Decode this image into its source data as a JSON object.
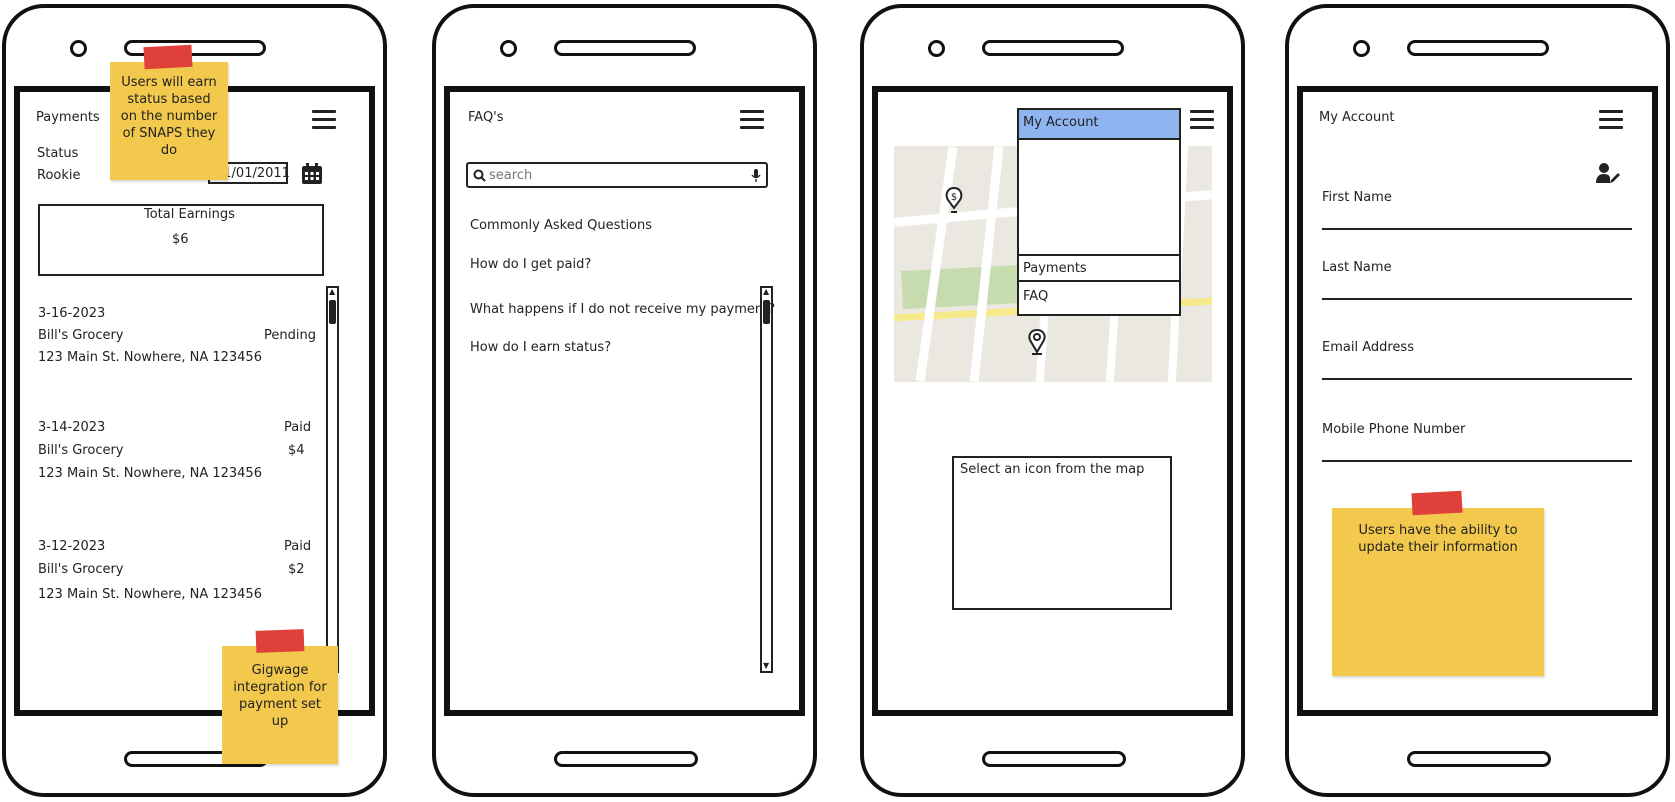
{
  "notes": {
    "status_note": "Users will earn status based on the number of SNAPS they do",
    "gigwage_note": "Gigwage integration for payment set up",
    "update_note": "Users have the ability to update their information"
  },
  "payments_screen": {
    "title": "Payments",
    "status_label": "Status",
    "status_value": "Rookie",
    "date_value": "01/01/2011",
    "total_label": "Total Earnings",
    "total_value": "$6",
    "transactions": [
      {
        "date": "3-16-2023",
        "store": "Bill's Grocery",
        "status": "Pending",
        "amount": "",
        "address": "123 Main St. Nowhere, NA 123456"
      },
      {
        "date": "3-14-2023",
        "store": "Bill's Grocery",
        "status": "Paid",
        "amount": "$4",
        "address": "123 Main St. Nowhere, NA 123456"
      },
      {
        "date": "3-12-2023",
        "store": "Bill's Grocery",
        "status": "Paid",
        "amount": "$2",
        "address": "123 Main St. Nowhere, NA 123456"
      }
    ]
  },
  "faq_screen": {
    "title": "FAQ's",
    "search_placeholder": "search",
    "heading": "Commonly Asked Questions",
    "questions": [
      "How do I get paid?",
      "What happens if I do not receive my payment?",
      "How do I earn status?"
    ]
  },
  "map_screen": {
    "menu_items": [
      "My Account",
      "Payments",
      "FAQ"
    ],
    "info_box_text": "Select an icon from the map",
    "colors": {
      "menu_selected": "#8fb5f0",
      "park": "#c6dcae",
      "road_highlight": "#f5e98a"
    }
  },
  "account_screen": {
    "title": "My Account",
    "fields": [
      "First Name",
      "Last Name",
      "Email Address",
      "Mobile Phone Number"
    ]
  }
}
